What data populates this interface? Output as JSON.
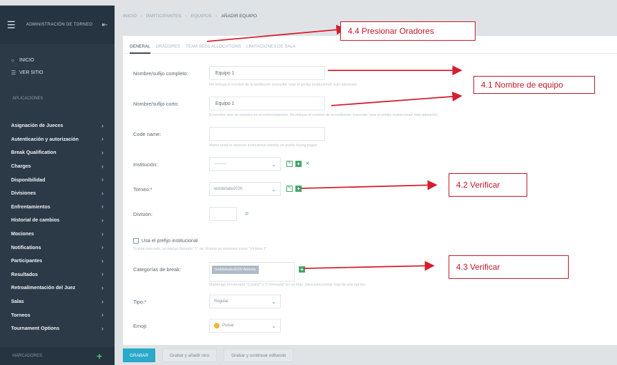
{
  "sidebar": {
    "header_title": "ADMINISTRACIÓN DE TORNEO",
    "top_items": [
      {
        "icon": "circle-icon",
        "label": "INICIO"
      },
      {
        "icon": "list-icon",
        "label": "VER SITIO"
      }
    ],
    "section_label": "APLICACIONES",
    "items": [
      {
        "label": "Asignación de Jueces"
      },
      {
        "label": "Autenticación y autorización"
      },
      {
        "label": "Break Qualification"
      },
      {
        "label": "Charges"
      },
      {
        "label": "Disponibilidad"
      },
      {
        "label": "Divisiones"
      },
      {
        "label": "Enfrentamientos"
      },
      {
        "label": "Historial de cambios"
      },
      {
        "label": "Mociones"
      },
      {
        "label": "Notifications"
      },
      {
        "label": "Participantes"
      },
      {
        "label": "Resultados"
      },
      {
        "label": "Retroalimentación del Juez"
      },
      {
        "label": "Salas"
      },
      {
        "label": "Torneos"
      },
      {
        "label": "Tournament Options"
      }
    ],
    "bottom_label": "MARCADORES"
  },
  "breadcrumb": [
    "INICIO",
    "PARTICIPANTES",
    "EQUIPOS",
    "AÑADIR EQUIPO"
  ],
  "tabs": [
    "GENERAL",
    "ORADORES",
    "TEAM SEED ALLOCATIONS",
    "LIMITACIONES DE SALA"
  ],
  "form": {
    "full_name_label": "Nombre/sufijo completo:",
    "full_name_value": "Equipo 1",
    "full_name_hint": "No incluya el nombre de la institución (consulte 'usar el prefijo institucional' más adelante)",
    "short_name_label": "Nombre/sufijo corto:",
    "short_name_value": "Equipo 1",
    "short_name_hint": "El nombre que se muestra en el enfrentamiento. No incluya el nombre de la institución (consulte 'usar el prefijo institucional' más adelante)",
    "code_name_label": "Code name:",
    "code_name_value": "",
    "code_name_hint": "Name used to obscure institutional identity on public-facing pages",
    "institution_label": "Institución:",
    "institution_value": "---------",
    "tournament_label": "Torneo:*",
    "tournament_value": "testdebate2020",
    "division_label": "División:",
    "division_value": "",
    "use_prefix_label": "Usa el prefijo institucional",
    "use_prefix_hint": "Si está marcado, un equipo llamado \"1\" de Victoria se mostrará como \"Victoria 1\"",
    "break_categories_label": "Categorías de break:",
    "break_categories_value": "testdebate2020 Abierta",
    "break_categories_hint": "Mantenga presionado \"Control\" o \"Command\" en un Mac, para seleccionar más de una opción.",
    "type_label": "Tipo:*",
    "type_value": "Regular",
    "emoji_label": "Emoji:",
    "emoji_value": "Pulsar"
  },
  "buttons": {
    "save": "GRABAR",
    "save_add": "Grabar y añadir otro",
    "save_continue": "Grabar y continuar editando"
  },
  "annotations": {
    "a44": "4.4 Presionar Oradores",
    "a41": "4.1 Nombre de equipo",
    "a42": "4.2 Verificar",
    "a43": "4.3 Verificar"
  },
  "colors": {
    "sidebar_bg": "#2c3a47",
    "accent": "#2aa9c9",
    "annotation_red": "#c0172a",
    "add_green": "#3fa66a"
  }
}
